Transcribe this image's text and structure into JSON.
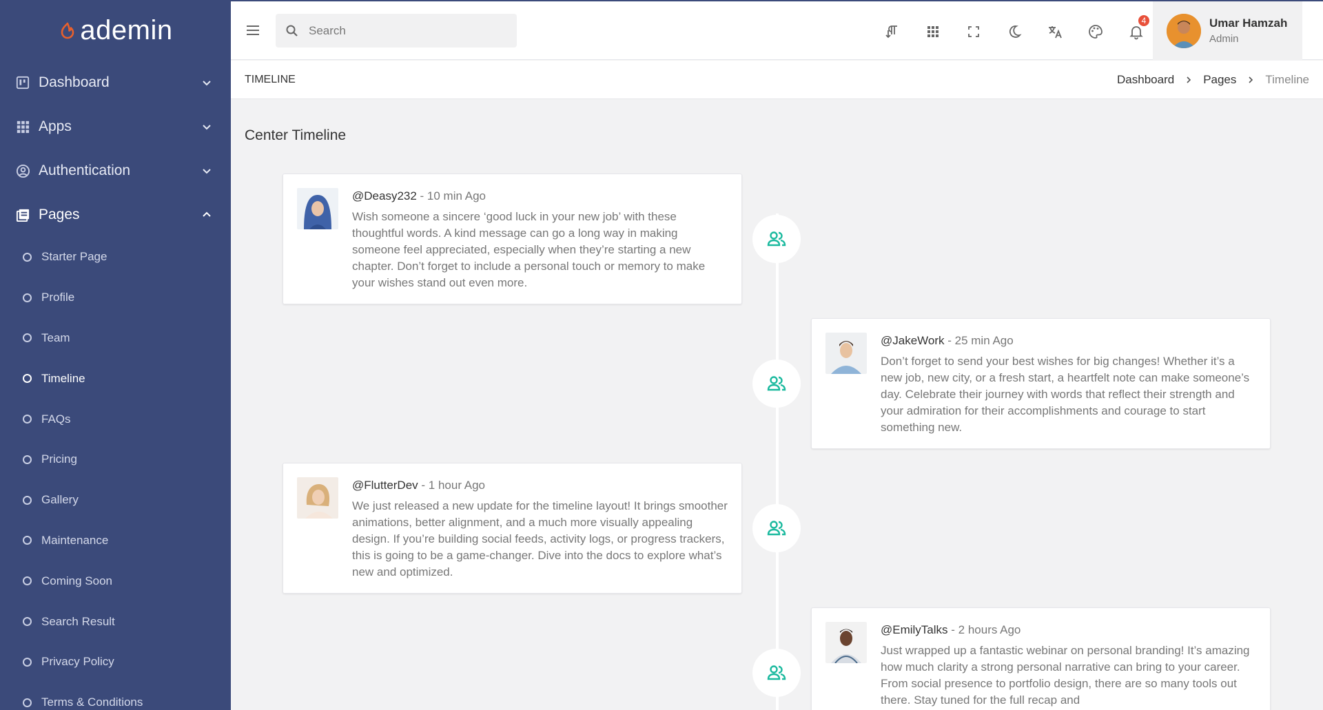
{
  "brand": {
    "logo_text": "ademin",
    "accent": "#e8602c"
  },
  "sidebar": {
    "bg": "#3b4a7a",
    "items": [
      {
        "label": "Dashboard",
        "icon": "dashboard-icon"
      },
      {
        "label": "Apps",
        "icon": "apps-grid-icon"
      },
      {
        "label": "Authentication",
        "icon": "user-circle-icon"
      },
      {
        "label": "Pages",
        "icon": "pages-icon"
      }
    ],
    "subitems": [
      {
        "label": "Starter Page"
      },
      {
        "label": "Profile"
      },
      {
        "label": "Team"
      },
      {
        "label": "Timeline"
      },
      {
        "label": "FAQs"
      },
      {
        "label": "Pricing"
      },
      {
        "label": "Gallery"
      },
      {
        "label": "Maintenance"
      },
      {
        "label": "Coming Soon"
      },
      {
        "label": "Search Result"
      },
      {
        "label": "Privacy Policy"
      },
      {
        "label": "Terms & Conditions"
      }
    ]
  },
  "header": {
    "search_placeholder": "Search",
    "icons": [
      "text-direction-icon",
      "apps-grid-icon",
      "fullscreen-icon",
      "moon-icon",
      "translate-icon",
      "palette-icon",
      "bell-icon"
    ],
    "notification_count": "4",
    "user": {
      "name": "Umar Hamzah",
      "role": "Admin"
    }
  },
  "breadcrumb": {
    "page_title": "TIMELINE",
    "items": [
      "Dashboard",
      "Pages",
      "Timeline"
    ]
  },
  "main": {
    "section_title": "Center Timeline",
    "accent": "#1ab99e",
    "posts": [
      {
        "handle": "@Deasy232",
        "time": " - 10 min Ago",
        "text": "Wish someone a sincere ‘good luck in your new job’ with these thoughtful words. A kind message can go a long way in making someone feel appreciated, especially when they’re starting a new chapter. Don’t forget to include a personal touch or memory to make your wishes stand out even more."
      },
      {
        "handle": "@JakeWork",
        "time": " - 25 min Ago",
        "text": "Don’t forget to send your best wishes for big changes! Whether it’s a new job, new city, or a fresh start, a heartfelt note can make someone’s day. Celebrate their journey with words that reflect their strength and your admiration for their accomplishments and courage to start something new."
      },
      {
        "handle": "@FlutterDev",
        "time": " - 1 hour Ago",
        "text": "We just released a new update for the timeline layout! It brings smoother animations, better alignment, and a much more visually appealing design. If you’re building social feeds, activity logs, or progress trackers, this is going to be a game-changer. Dive into the docs to explore what’s new and optimized."
      },
      {
        "handle": "@EmilyTalks",
        "time": " - 2 hours Ago",
        "text": "Just wrapped up a fantastic webinar on personal branding! It’s amazing how much clarity a strong personal narrative can bring to your career. From social presence to portfolio design, there are so many tools out there. Stay tuned for the full recap and"
      }
    ]
  }
}
